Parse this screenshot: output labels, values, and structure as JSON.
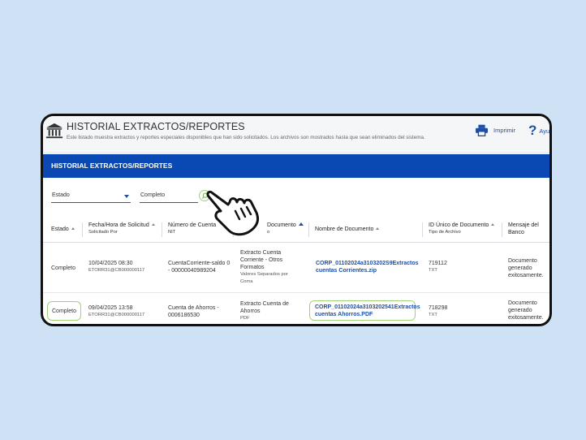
{
  "header": {
    "title": "HISTORIAL EXTRACTOS/REPORTES",
    "subtitle": "Este listado muestra extractos y reportes especiales disponibles que han sido solicitados. Los archivos son mostrados hasta que sean eliminados del sistema.",
    "print_label": "Imprimir",
    "help_label": "Ayud"
  },
  "section": {
    "title": "HISTORIAL EXTRACTOS/REPORTES"
  },
  "filters": {
    "field_select": "Estado",
    "value_input": "Completo"
  },
  "table": {
    "headers": {
      "estado": "Estado",
      "fecha": "Fecha/Hora de Solicitud",
      "fecha_sub": "Solicitado Por",
      "cuenta": "Número de Cuenta",
      "cuenta_sub": "NIT",
      "documento": "Documento",
      "documento_sub": "o",
      "nombre": "Nombre de Documento",
      "id": "ID Único de Documento",
      "id_sub": "Tipo de Archivo",
      "mensaje": "Mensaje del Banco"
    },
    "rows": [
      {
        "estado": "Completo",
        "fecha": "10/04/2025 08:30",
        "solicitante": "ETORR31@CB000000117",
        "cuenta": "CuentaCorriente-saldo 0 - 00000040989204",
        "documento": "Extracto Cuenta Corriente - Otros Formatos",
        "documento_formato": "Valores Separados por Coma",
        "nombre": "CORP_01102024a3103202S9Extractos cuentas Corrientes.zip",
        "id": "719112",
        "tipo": "TXT",
        "mensaje": "Documento generado exitosamente."
      },
      {
        "estado": "Completo",
        "fecha": "09/04/2025 13:58",
        "solicitante": "ETORR31@CB000000117",
        "cuenta": "Cuenta de Ahorros - 0006186530",
        "documento": "Extracto Cuenta de Ahorros",
        "documento_formato": "PDF",
        "nombre": "CORP_01102024a3103202541Extractos cuentas Ahorros.PDF",
        "id": "718298",
        "tipo": "TXT",
        "mensaje": "Documento generado exitosamente."
      }
    ]
  },
  "colors": {
    "background": "#cfe1f5",
    "brand_blue": "#0a48b4",
    "link_blue": "#1d4fa8",
    "highlight_green": "#9fd27a"
  },
  "icons": [
    "bank-icon",
    "printer-icon",
    "help-icon",
    "search-icon",
    "caret-down-icon",
    "pointing-hand-icon"
  ]
}
